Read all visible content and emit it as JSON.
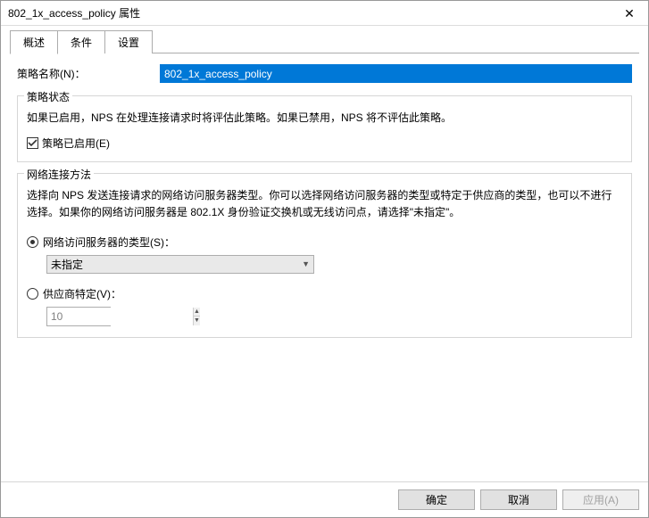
{
  "window": {
    "title": "802_1x_access_policy 属性"
  },
  "tabs": {
    "overview": "概述",
    "conditions": "条件",
    "settings": "设置"
  },
  "policyName": {
    "label": "策略名称(N)：",
    "value": "802_1x_access_policy"
  },
  "policyStatus": {
    "title": "策略状态",
    "desc": "如果已启用，NPS 在处理连接请求时将评估此策略。如果已禁用，NPS 将不评估此策略。",
    "enabledLabel": "策略已启用(E)"
  },
  "connectionMethod": {
    "title": "网络连接方法",
    "desc": "选择向 NPS 发送连接请求的网络访问服务器类型。你可以选择网络访问服务器的类型或特定于供应商的类型，也可以不进行选择。如果你的网络访问服务器是 802.1X 身份验证交换机或无线访问点，请选择\"未指定\"。",
    "radioServerType": "网络访问服务器的类型(S)：",
    "selectServerType": "未指定",
    "radioVendor": "供应商特定(V)：",
    "vendorValue": "10"
  },
  "buttons": {
    "ok": "确定",
    "cancel": "取消",
    "apply": "应用(A)"
  }
}
